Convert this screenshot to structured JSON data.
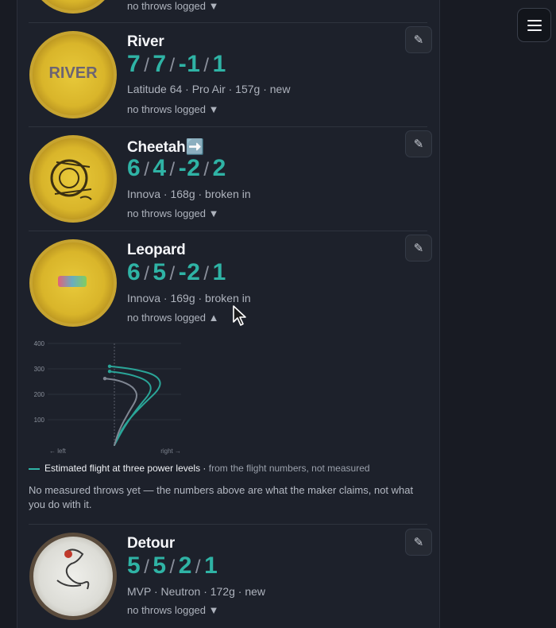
{
  "discs": [
    {
      "name": "",
      "flight": {
        "speed": "",
        "glide": "",
        "turn": "",
        "fade": ""
      },
      "meta": "",
      "throws": "no throws logged ▼"
    },
    {
      "name": "River",
      "flight": {
        "speed": "7",
        "glide": "7",
        "turn": "-1",
        "fade": "1"
      },
      "meta": "Latitude 64 · Pro Air · 157g · new",
      "throws": "no throws logged ▼",
      "stamp": "RIVER"
    },
    {
      "name": "Cheetah➡️",
      "flight": {
        "speed": "6",
        "glide": "4",
        "turn": "-2",
        "fade": "2"
      },
      "meta": "Innova · 168g · broken in",
      "throws": "no throws logged ▼"
    },
    {
      "name": "Leopard",
      "flight": {
        "speed": "6",
        "glide": "5",
        "turn": "-2",
        "fade": "1"
      },
      "meta": "Innova · 169g · broken in",
      "throws": "no throws logged ▲"
    },
    {
      "name": "Detour",
      "flight": {
        "speed": "5",
        "glide": "5",
        "turn": "2",
        "fade": "1"
      },
      "meta": "MVP · Neutron · 172g · new",
      "throws": "no throws logged ▼"
    }
  ],
  "edit_label": "✎",
  "chart_data": {
    "type": "line",
    "title": "",
    "y_ticks": [
      "400",
      "300",
      "200",
      "100"
    ],
    "x_left_label": "← left",
    "x_right_label": "right →",
    "ylim": [
      0,
      400
    ],
    "series": [
      {
        "name": "",
        "points": [
          [
            0,
            0
          ],
          [
            2,
            80
          ],
          [
            6,
            160
          ],
          [
            10,
            230
          ],
          [
            9,
            275
          ],
          [
            4,
            300
          ],
          [
            -1,
            310
          ]
        ],
        "color": "#2aa598"
      },
      {
        "name": "",
        "points": [
          [
            0,
            0
          ],
          [
            2,
            70
          ],
          [
            5,
            150
          ],
          [
            8,
            215
          ],
          [
            7,
            255
          ],
          [
            3,
            280
          ],
          [
            -1,
            290
          ]
        ],
        "color": "#2aa598"
      },
      {
        "name": "",
        "points": [
          [
            0,
            0
          ],
          [
            1,
            60
          ],
          [
            3,
            130
          ],
          [
            5,
            190
          ],
          [
            4,
            230
          ],
          [
            1,
            255
          ],
          [
            -2,
            262
          ]
        ],
        "color": "#7f8692"
      }
    ]
  },
  "legend": {
    "main": "Estimated flight at three power levels ·",
    "note": "from the flight numbers, not measured"
  },
  "no_throws_note": "No measured throws yet — the numbers above are what the maker claims, not what you do with it.",
  "colors": {
    "accent": "#2fb3a5",
    "background": "#181b23",
    "panel": "#1d212b"
  },
  "icons": {
    "menu": "hamburger-menu-icon",
    "edit": "pencil-icon",
    "cursor": "mouse-pointer-icon"
  }
}
